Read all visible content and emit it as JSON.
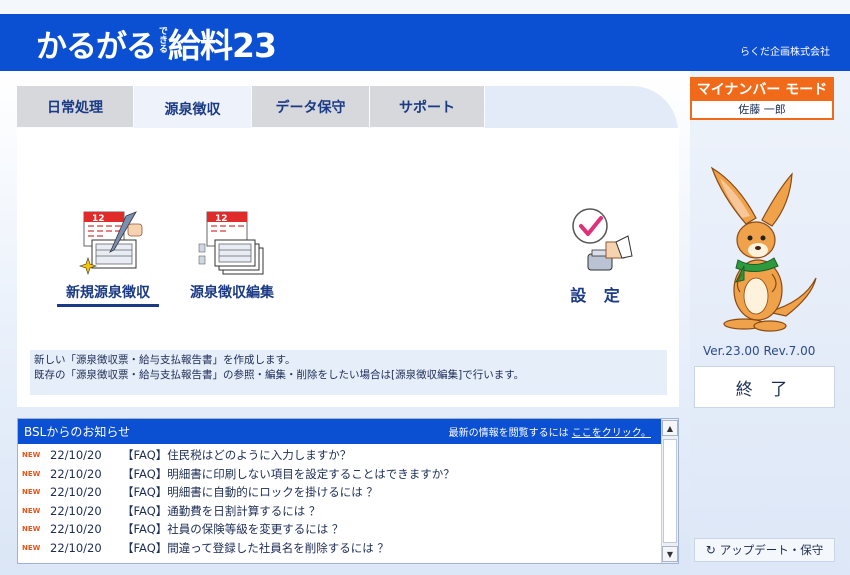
{
  "header": {
    "logo_main": "かるがる",
    "logo_small": "できる",
    "logo_product": "給料23",
    "company": "らくだ企画株式会社"
  },
  "tabs": [
    {
      "label": "日常処理",
      "active": false
    },
    {
      "label": "源泉徴収",
      "active": true
    },
    {
      "label": "データ保守",
      "active": false
    },
    {
      "label": "サポート",
      "active": false
    }
  ],
  "functions": {
    "new": {
      "label": "新規源泉徴収",
      "icon": "calendar-pen-icon",
      "selected": true
    },
    "edit": {
      "label": "源泉徴収編集",
      "icon": "calendar-documents-icon"
    },
    "settings": {
      "label": "設 定",
      "icon": "check-stamp-icon"
    }
  },
  "description": {
    "line1": "新しい「源泉徴収票・給与支払報告書」を作成します。",
    "line2": "既存の「源泉徴収票・給与支払報告書」の参照・編集・削除をしたい場合は[源泉徴収編集]で行います。"
  },
  "news": {
    "title": "BSLからのお知らせ",
    "note_prefix": "最新の情報を閲覧するには ",
    "note_link": "ここをクリック。",
    "items": [
      {
        "badge": "NEW",
        "date": "22/10/20",
        "text": "【FAQ】住民税はどのように入力しますか？"
      },
      {
        "badge": "NEW",
        "date": "22/10/20",
        "text": "【FAQ】明細書に印刷しない項目を設定することはできますか？"
      },
      {
        "badge": "NEW",
        "date": "22/10/20",
        "text": "【FAQ】明細書に自動的にロックを掛けるには ？"
      },
      {
        "badge": "NEW",
        "date": "22/10/20",
        "text": "【FAQ】通勤費を日割計算するには ？"
      },
      {
        "badge": "NEW",
        "date": "22/10/20",
        "text": "【FAQ】社員の保険等級を変更するには ？"
      },
      {
        "badge": "NEW",
        "date": "22/10/20",
        "text": "【FAQ】間違って登録した社員名を削除するには ？"
      }
    ]
  },
  "mynumber": {
    "label": "マイナンバー モード",
    "user": "佐藤 一郎"
  },
  "version": "Ver.23.00 Rev.7.00",
  "exit_label": "終 了",
  "update_label": "アップデート・保守",
  "colors": {
    "header_blue": "#0b4fd3",
    "accent_orange": "#f06a1a",
    "text_navy": "#1b3a85",
    "new_badge": "#e8541a"
  }
}
